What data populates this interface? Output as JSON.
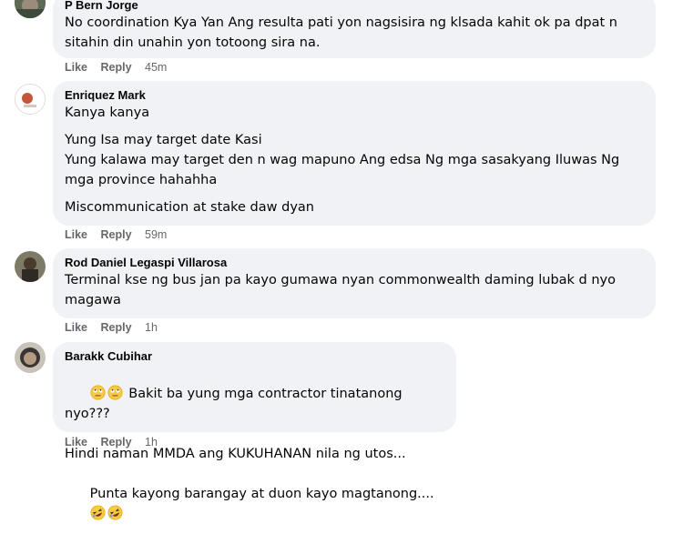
{
  "comments": [
    {
      "author": "P Bern Jorge",
      "lines": [
        "No coordination Kya Yan Ang resulta pati yon nagsisira ng klsada kahit ok pa dpat n",
        "sitahin din unahin yon totoong sira na."
      ],
      "like": "Like",
      "reply": "Reply",
      "time": "45m"
    },
    {
      "author": "Enriquez Mark",
      "lines": [
        "Kanya kanya",
        "",
        "Yung Isa may target date Kasi",
        "Yung kalawa may target den n wag mapuno Ang edsa Ng mga sasakyang Iluwas Ng",
        "mga province hahahha",
        "",
        "Miscommunication at stake daw dyan"
      ],
      "like": "Like",
      "reply": "Reply",
      "time": "59m"
    },
    {
      "author": "Rod Daniel Legaspi Villarosa",
      "lines": [
        "Terminal kse ng bus jan pa kayo gumawa nyan commonwealth daming lubak d nyo",
        "magawa"
      ],
      "like": "Like",
      "reply": "Reply",
      "time": "1h"
    },
    {
      "author": "Barakk Cubihar",
      "line1": "Bakit ba yung mga contractor tinatanong nyo???",
      "line2": "Hindi naman MMDA ang KUKUHANAN nila ng utos...",
      "line3": "Punta kayong barangay at duon kayo magtanong....",
      "like": "Like",
      "reply": "Reply",
      "time": "1h"
    }
  ],
  "colors": {
    "bubble": "#f0f2f5",
    "meta": "#65676b",
    "text": "#050505"
  },
  "icons": [
    "rolling-eyes-emoji-icon",
    "rolling-on-floor-laughing-emoji-icon"
  ]
}
